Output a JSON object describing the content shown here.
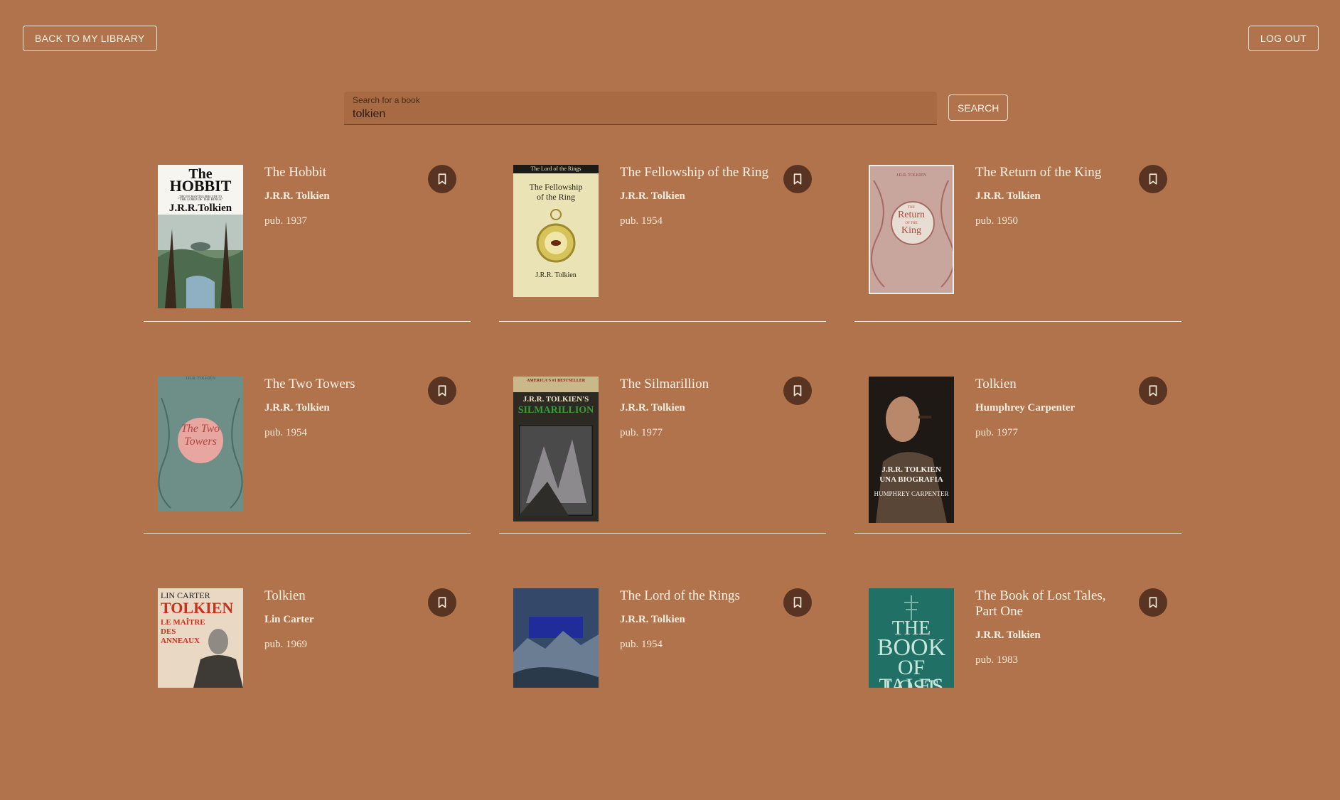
{
  "header": {
    "back_label": "BACK TO MY LIBRARY",
    "logout_label": "LOG OUT"
  },
  "search": {
    "label": "Search for a book",
    "value": "tolkien",
    "button_label": "SEARCH"
  },
  "books": [
    {
      "title": "The Hobbit",
      "author": "J.R.R. Tolkien",
      "pub": "pub. 1937",
      "cover": {
        "lines": [
          "The",
          "HOBBIT",
          "THE ENCHANTING PRELUDE TO",
          "\"THE LORD OF THE RINGS\"",
          "J.R.R.Tolkien"
        ]
      }
    },
    {
      "title": "The Fellowship of the Ring",
      "author": "J.R.R. Tolkien",
      "pub": "pub. 1954",
      "cover": {
        "lines": [
          "The Lord of the Rings",
          "The Fellowship",
          "of the Ring",
          "J.R.R. Tolkien"
        ]
      }
    },
    {
      "title": "The Return of the King",
      "author": "J.R.R. Tolkien",
      "pub": "pub. 1950",
      "cover": {
        "lines": [
          "J.R.R. TOLKIEN",
          "THE",
          "Return",
          "OF THE",
          "King"
        ]
      }
    },
    {
      "title": "The Two Towers",
      "author": "J.R.R. Tolkien",
      "pub": "pub. 1954",
      "cover": {
        "lines": [
          "J.R.R. TOLKIEN",
          "The Two",
          "Towers"
        ]
      }
    },
    {
      "title": "The Silmarillion",
      "author": "J.R.R. Tolkien",
      "pub": "pub. 1977",
      "cover": {
        "lines": [
          "AMERICA'S #1 BESTSELLER",
          "J.R.R. TOLKIEN'S",
          "SILMARILLION"
        ]
      }
    },
    {
      "title": "Tolkien",
      "author": "Humphrey Carpenter",
      "pub": "pub. 1977",
      "cover": {
        "lines": [
          "J.R.R. TOLKIEN",
          "UNA BIOGRAFIA",
          "HUMPHREY CARPENTER"
        ]
      }
    },
    {
      "title": "Tolkien",
      "author": "Lin Carter",
      "pub": "pub. 1969",
      "cover": {
        "lines": [
          "LIN CARTER",
          "TOLKIEN",
          "LE MAÎTRE",
          "DES",
          "ANNEAUX"
        ]
      }
    },
    {
      "title": "The Lord of the Rings",
      "author": "J.R.R. Tolkien",
      "pub": "pub. 1954",
      "cover": {
        "lines": []
      }
    },
    {
      "title": "The Book of Lost Tales, Part One",
      "author": "J.R.R. Tolkien",
      "pub": "pub. 1983",
      "cover": {
        "lines": [
          "THE",
          "BOOK",
          "OF LOST",
          "TALES"
        ]
      }
    }
  ],
  "colors": {
    "background": "#b0734b",
    "bookmark_button": "#5a3422",
    "text": "#fbeee0"
  },
  "icons": {
    "bookmark": "bookmark-icon"
  }
}
